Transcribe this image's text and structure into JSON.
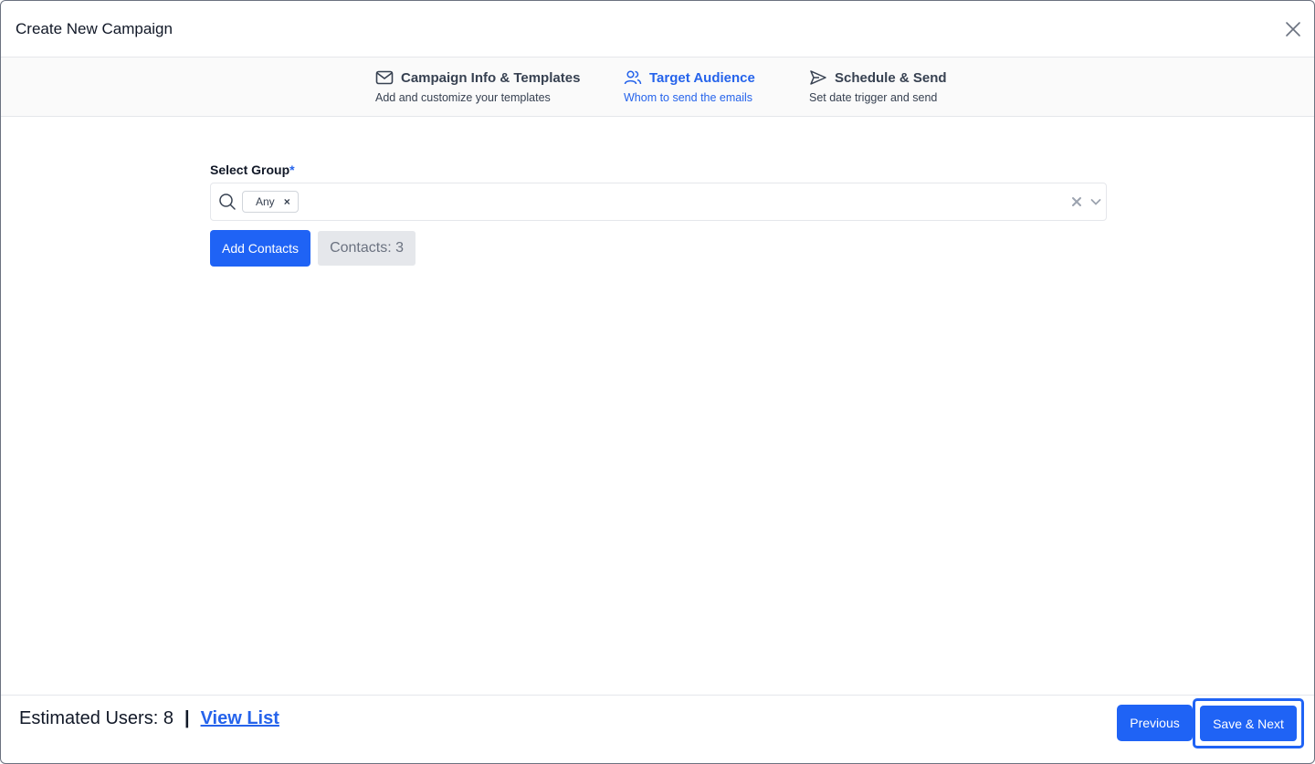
{
  "modal": {
    "title": "Create New Campaign"
  },
  "steps": [
    {
      "icon": "mail-icon",
      "title": "Campaign Info & Templates",
      "subtitle": "Add and customize your templates",
      "active": false
    },
    {
      "icon": "users-icon",
      "title": "Target Audience",
      "subtitle": "Whom to send the emails",
      "active": true
    },
    {
      "icon": "send-icon",
      "title": "Schedule & Send",
      "subtitle": "Set date trigger and send",
      "active": false
    }
  ],
  "form": {
    "group_label": "Select Group",
    "required_mark": "*",
    "selected_chip": "Any",
    "chip_remove": "×",
    "add_contacts_label": "Add Contacts",
    "contacts_count": "Contacts: 3"
  },
  "footer": {
    "estimated_users": "Estimated Users: 8",
    "separator": "|",
    "view_list_label": "View List",
    "previous_label": "Previous",
    "next_label": "Save & Next"
  },
  "colors": {
    "accent": "#1f63f5",
    "active_step": "#2563eb",
    "count_bg": "#e5e7eb"
  }
}
